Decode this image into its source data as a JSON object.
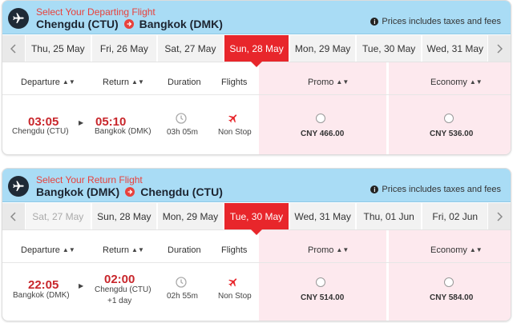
{
  "common": {
    "prices_note": "Prices includes taxes and fees",
    "columns": {
      "departure": "Departure",
      "return": "Return",
      "duration": "Duration",
      "flights": "Flights",
      "promo": "Promo",
      "economy": "Economy"
    }
  },
  "departing": {
    "select_label": "Select Your Departing Flight",
    "origin": "Chengdu (CTU)",
    "destination": "Bangkok (DMK)",
    "dates": [
      {
        "label": "Thu, 25 May",
        "state": "normal"
      },
      {
        "label": "Fri, 26 May",
        "state": "normal"
      },
      {
        "label": "Sat, 27 May",
        "state": "normal"
      },
      {
        "label": "Sun, 28 May",
        "state": "active"
      },
      {
        "label": "Mon, 29 May",
        "state": "normal"
      },
      {
        "label": "Tue, 30 May",
        "state": "normal"
      },
      {
        "label": "Wed, 31 May",
        "state": "normal"
      }
    ],
    "flight": {
      "dep_time": "03:05",
      "dep_city": "Chengdu (CTU)",
      "arr_time": "05:10",
      "arr_city": "Bangkok (DMK)",
      "duration": "03h 05m",
      "stops": "Non Stop",
      "promo_price": "CNY 466.00",
      "economy_price": "CNY 536.00"
    }
  },
  "returning": {
    "select_label": "Select Your Return Flight",
    "origin": "Bangkok (DMK)",
    "destination": "Chengdu (CTU)",
    "dates": [
      {
        "label": "Sat, 27 May",
        "state": "disabled"
      },
      {
        "label": "Sun, 28 May",
        "state": "normal"
      },
      {
        "label": "Mon, 29 May",
        "state": "normal"
      },
      {
        "label": "Tue, 30 May",
        "state": "active"
      },
      {
        "label": "Wed, 31 May",
        "state": "normal"
      },
      {
        "label": "Thu, 01 Jun",
        "state": "normal"
      },
      {
        "label": "Fri, 02 Jun",
        "state": "normal"
      }
    ],
    "flight": {
      "dep_time": "22:05",
      "dep_city": "Bangkok (DMK)",
      "arr_time": "02:00",
      "arr_city": "Chengdu (CTU)",
      "plus_day": "+1 day",
      "duration": "02h 55m",
      "stops": "Non Stop",
      "promo_price": "CNY 514.00",
      "economy_price": "CNY 584.00"
    }
  },
  "colors": {
    "accent_red": "#e8262b",
    "header_blue": "#a9dcf5",
    "fare_pink": "#fde9ee"
  }
}
